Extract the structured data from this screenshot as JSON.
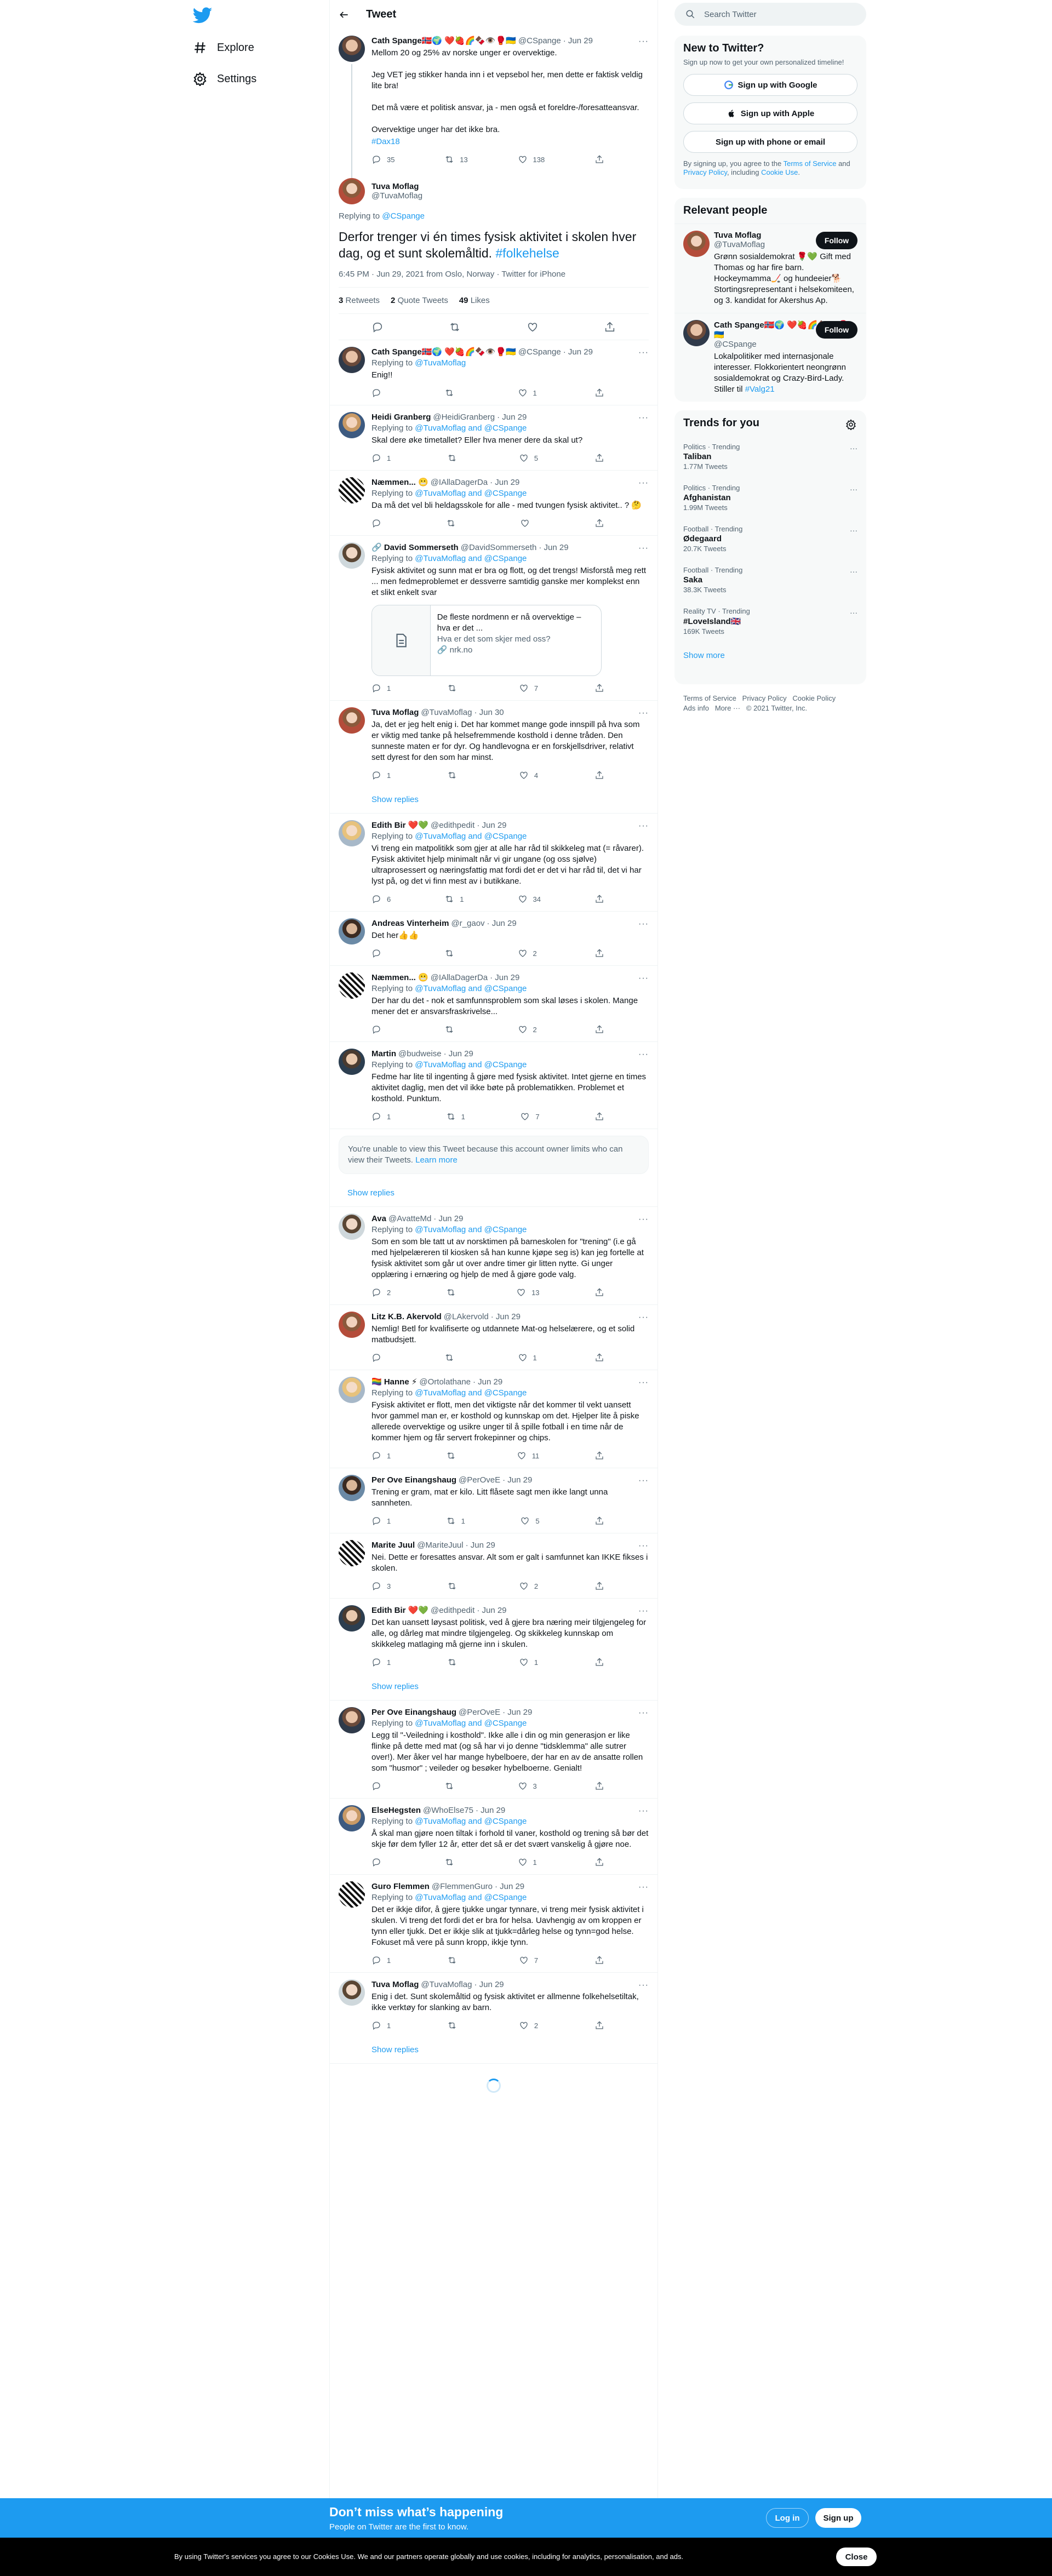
{
  "nav": {
    "explore": "Explore",
    "settings": "Settings"
  },
  "header": {
    "title": "Tweet"
  },
  "parent": {
    "name": "Cath Spange🇳🇴🌍 ❤️🍓🌈🍫👁️🥊🇺🇦",
    "handle": "@CSpange",
    "time": "· Jun 29",
    "text": "Mellom 20 og 25% av norske unger er overvektige.\n\nJeg VET jeg stikker handa inn i et vepsebol her, men dette er faktisk veldig lite bra!\n\nDet må være et politisk ansvar, ja - men også et foreldre-/foresatteansvar.\n\nOvervektige unger har det ikke bra.",
    "hashtag": "#Dax18",
    "replies": "35",
    "retweets": "13",
    "likes": "138"
  },
  "focus": {
    "name": "Tuva Moflag",
    "handle": "@TuvaMoflag",
    "replying_prefix": "Replying to",
    "replying_to": "@CSpange",
    "text": "Derfor trenger vi én times fysisk aktivitet i skolen hver dag, og et sunt skolemåltid.",
    "hashtag": "#folkehelse",
    "meta": "6:45 PM · Jun 29, 2021 from Oslo, Norway · Twitter for iPhone",
    "retweets_num": "3",
    "retweets_label": "Retweets",
    "quotes_num": "2",
    "quotes_label": "Quote Tweets",
    "likes_num": "49",
    "likes_label": "Likes"
  },
  "replies": [
    {
      "name": "Cath Spange🇳🇴🌍 ❤️🍓🌈🍫👁️🥊🇺🇦",
      "handle": "@CSpange",
      "time": "· Jun 29",
      "replying": "@TuvaMoflag",
      "text": "Enig!!",
      "r": "",
      "rt": "",
      "l": "1"
    },
    {
      "name": "Heidi Granberg",
      "handle": "@HeidiGranberg",
      "time": "· Jun 29",
      "replying": "@TuvaMoflag and @CSpange",
      "text": "Skal dere øke timetallet? Eller hva mener dere da skal ut?",
      "r": "1",
      "rt": "",
      "l": "5"
    },
    {
      "name": "Næmmen... 😬",
      "handle": "@IAllaDagerDa",
      "time": "· Jun 29",
      "replying": "@TuvaMoflag and @CSpange",
      "text": "Da må det vel bli heldagsskole for alle - med tvungen fysisk aktivitet.. ? 🤔",
      "r": "",
      "rt": "",
      "l": ""
    },
    {
      "name": "🔗 David Sommerseth",
      "handle": "@DavidSommerseth",
      "time": "· Jun 29",
      "replying": "@TuvaMoflag and @CSpange",
      "text": "Fysisk aktivitet og sunn mat er bra og flott, og det trengs! Misforstå meg rett ... men fedmeproblemet er dessverre samtidig ganske mer komplekst enn et slikt enkelt svar",
      "card_title": "De fleste nordmenn er nå overvektige – hva er det ...",
      "card_desc": "Hva er det som skjer med oss?",
      "card_link": "🔗 nrk.no",
      "r": "1",
      "rt": "",
      "l": "7"
    },
    {
      "name": "Tuva Moflag",
      "handle": "@TuvaMoflag",
      "time": "· Jun 30",
      "replying": "",
      "text": "Ja, det er jeg helt enig i. Det har kommet mange gode innspill på hva som er viktig med tanke på helsefremmende kosthold i denne tråden. Den sunneste maten er for dyr. Og handlevogna er en forskjellsdriver, relativt sett dyrest for den som har minst.",
      "r": "1",
      "rt": "",
      "l": "4",
      "showreplies": "Show replies"
    },
    {
      "name": "Edith Bir ❤️💚",
      "handle": "@edithpedit",
      "time": "· Jun 29",
      "replying": "@TuvaMoflag and @CSpange",
      "text": "Vi treng ein matpolitikk som gjer at alle har råd til skikkeleg mat (= råvarer). Fysisk aktivitet hjelp minimalt når vi gir ungane (og oss sjølve) ultraprosessert og næringsfattig mat fordi det er det vi har råd til, det vi har lyst på, og det vi finn mest av i butikkane.",
      "r": "6",
      "rt": "1",
      "l": "34"
    },
    {
      "name": "Andreas Vinterheim",
      "handle": "@r_gaov",
      "time": "· Jun 29",
      "replying": "",
      "text": "Det her👍👍",
      "r": "",
      "rt": "",
      "l": "2"
    },
    {
      "name": "Næmmen... 😬",
      "handle": "@IAllaDagerDa",
      "time": "· Jun 29",
      "replying": "@TuvaMoflag and @CSpange",
      "text": "Der har du det - nok et samfunnsproblem som skal løses i skolen. Mange mener det er ansvarsfraskrivelse...",
      "r": "",
      "rt": "",
      "l": "2"
    },
    {
      "name": "Martin",
      "handle": "@budweise",
      "time": "· Jun 29",
      "replying": "@TuvaMoflag and @CSpange",
      "text": "Fedme har lite til ingenting å gjøre med fysisk aktivitet. Intet gjerne en times aktivitet daglig, men det vil ikke bøte på problematikken. Problemet et kosthold. Punktum.",
      "r": "1",
      "rt": "1",
      "l": "7"
    }
  ],
  "hidden_note": {
    "text": "You're unable to view this Tweet because this account owner limits who can view their Tweets.",
    "link": "Learn more"
  },
  "show_replies_2": "Show replies",
  "replies2": [
    {
      "name": "Ava",
      "handle": "@AvatteMd",
      "time": "· Jun 29",
      "replying": "@TuvaMoflag and @CSpange",
      "text": "Som en som ble tatt ut av norsktimen på barneskolen for \"trening\" (i.e gå med hjelpelæreren til kiosken så han kunne kjøpe seg is) kan jeg fortelle at fysisk aktivitet som går ut over andre timer gir litten nytte. Gi unger opplæring i ernæring og hjelp de med å gjøre gode valg.",
      "r": "2",
      "rt": "",
      "l": "13"
    },
    {
      "name": "Litz K.B. Akervold",
      "handle": "@LAkervold",
      "time": "· Jun 29",
      "replying": "",
      "text": "Nemlig! Betl for kvalifiserte og utdannete Mat-og helselærere, og et solid matbudsjett.",
      "r": "",
      "rt": "",
      "l": "1"
    },
    {
      "name": "🏳️‍🌈 Hanne ⚡",
      "handle": "@Ortolathane",
      "time": "· Jun 29",
      "replying": "@TuvaMoflag and @CSpange",
      "text": "Fysisk aktivitet er flott, men det viktigste når det kommer til vekt uansett hvor gammel man er, er kosthold og kunnskap om det. Hjelper lite å piske allerede overvektige og usikre unger til å spille fotball i en time når de kommer hjem og får servert frokepinner og chips.",
      "r": "1",
      "rt": "",
      "l": "11"
    },
    {
      "name": "Per Ove Einangshaug",
      "handle": "@PerOveE",
      "time": "· Jun 29",
      "replying": "",
      "text": "Trening er gram, mat er kilo. Litt flåsete sagt men ikke langt unna sannheten.",
      "r": "1",
      "rt": "1",
      "l": "5"
    },
    {
      "name": "Marite Juul",
      "handle": "@MariteJuul",
      "time": "· Jun 29",
      "replying": "",
      "text": "Nei. Dette er foresattes ansvar. Alt som er galt i samfunnet kan IKKE fikses i skolen.",
      "r": "3",
      "rt": "",
      "l": "2"
    },
    {
      "name": "Edith Bir ❤️💚",
      "handle": "@edithpedit",
      "time": "· Jun 29",
      "replying": "",
      "text": "Det kan uansett løysast politisk, ved å gjere bra næring meir tilgjengeleg for alle, og dårleg mat mindre tilgjengeleg. Og skikkeleg kunnskap om skikkeleg matlaging må gjerne inn i skulen.",
      "r": "1",
      "rt": "",
      "l": "1",
      "showreplies": "Show replies"
    },
    {
      "name": "Per Ove Einangshaug",
      "handle": "@PerOveE",
      "time": "· Jun 29",
      "replying": "@TuvaMoflag and @CSpange",
      "text": "Legg til \"-Veiledning i kosthold\". Ikke alle i din og min generasjon er like flinke på dette med mat (og så har vi jo denne \"tidsklemma\" alle sutrer over!). Mer åker vel har mange hybelboere, der har en av de ansatte rollen som \"husmor\" ; veileder og besøker hybelboerne. Genialt!",
      "r": "",
      "rt": "",
      "l": "3"
    },
    {
      "name": "ElseHegsten",
      "handle": "@WhoElse75",
      "time": "· Jun 29",
      "replying": "@TuvaMoflag and @CSpange",
      "text": "Å skal man gjøre noen tiltak i forhold til vaner, kosthold og trening så bør det skje før dem fyller 12 år, etter det så er det svært vanskelig å gjøre noe.",
      "r": "",
      "rt": "",
      "l": "1"
    },
    {
      "name": "Guro Flemmen",
      "handle": "@FlemmenGuro",
      "time": "· Jun 29",
      "replying": "@TuvaMoflag and @CSpange",
      "text": "Det er ikkje difor, å gjere tjukke ungar tynnare, vi treng meir fysisk aktivitet i skulen. Vi treng det fordi det er bra for helsa. Uavhengig av om kroppen er tynn eller tjukk. Det er ikkje slik at tjukk=dårleg helse og tynn=god helse. Fokuset må vere på sunn kropp, ikkje tynn.",
      "r": "1",
      "rt": "",
      "l": "7"
    },
    {
      "name": "Tuva Moflag",
      "handle": "@TuvaMoflag",
      "time": "· Jun 29",
      "replying": "",
      "text": "Enig i det. Sunt skolemåltid og fysisk aktivitet er allmenne folkehelsetiltak, ikke verktøy for slanking av barn.",
      "r": "1",
      "rt": "",
      "l": "2",
      "showreplies": "Show replies"
    }
  ],
  "right": {
    "search_placeholder": "Search Twitter",
    "new_title": "New to Twitter?",
    "new_sub": "Sign up now to get your own personalized timeline!",
    "google": "Sign up with Google",
    "apple": "Sign up with Apple",
    "phone": "Sign up with phone or email",
    "fine1": "By signing up, you agree to the",
    "terms": "Terms of Service",
    "and": "and",
    "privacy": "Privacy Policy",
    "fine2": ", including",
    "cookie_use": "Cookie Use",
    "relevant_title": "Relevant people",
    "people": [
      {
        "name": "Tuva Moflag",
        "handle": "@TuvaMoflag",
        "bio": "Grønn sosialdemokrat 🌹💚 Gift med Thomas og har fire barn. Hockeymamma🏒 og hundeeier🐕 Stortingsrepresentant i helsekomiteen, og 3. kandidat for Akershus Ap.",
        "follow": "Follow"
      },
      {
        "name": "Cath Spange🇳🇴🌍 ❤️🍓🌈🍫👁️🥊🇺🇦",
        "handle": "@CSpange",
        "bio": "Lokalpolitiker med internasjonale interesser. Flokkorientert neongrønn sosialdemokrat og Crazy-Bird-Lady. Stiller til",
        "bio_tag": "#Valg21",
        "follow": "Follow"
      }
    ],
    "trends_title": "Trends for you",
    "trends": [
      {
        "cat": "Politics · Trending",
        "name": "Taliban",
        "count": "1.77M Tweets"
      },
      {
        "cat": "Politics · Trending",
        "name": "Afghanistan",
        "count": "1.99M Tweets"
      },
      {
        "cat": "Football · Trending",
        "name": "Ødegaard",
        "count": "20.7K Tweets"
      },
      {
        "cat": "Football · Trending",
        "name": "Saka",
        "count": "38.3K Tweets"
      },
      {
        "cat": "Reality TV · Trending",
        "name": "#LoveIsland🇬🇧",
        "count": "169K Tweets"
      }
    ],
    "show_more": "Show more",
    "footer": [
      "Terms of Service",
      "Privacy Policy",
      "Cookie Policy",
      "Ads info",
      "More ···",
      "© 2021 Twitter, Inc."
    ]
  },
  "bottombar": {
    "title": "Don’t miss what’s happening",
    "sub": "People on Twitter are the first to know.",
    "login": "Log in",
    "signup": "Sign up"
  },
  "cookie": {
    "text": "By using Twitter's services you agree to our Cookies Use. We and our partners operate globally and use cookies, including for analytics, personalisation, and ads.",
    "close": "Close"
  },
  "colors": {
    "accent": "#1d9bf0",
    "text": "#0f1419",
    "muted": "#536471"
  }
}
